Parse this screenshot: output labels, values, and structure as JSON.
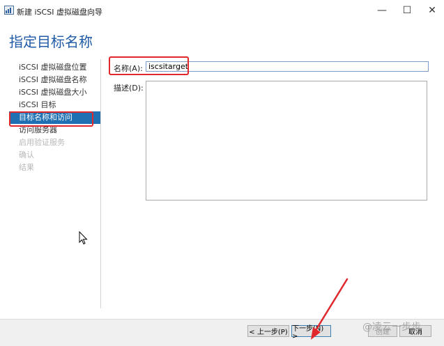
{
  "window": {
    "title": "新建 iSCSI 虚拟磁盘向导",
    "controls": {
      "minimize": "—",
      "maximize": "☐",
      "close": "✕"
    }
  },
  "page": {
    "title": "指定目标名称"
  },
  "sidebar": {
    "items": [
      {
        "label": "iSCSI 虚拟磁盘位置",
        "state": "normal"
      },
      {
        "label": "iSCSI 虚拟磁盘名称",
        "state": "normal"
      },
      {
        "label": "iSCSI 虚拟磁盘大小",
        "state": "normal"
      },
      {
        "label": "iSCSI 目标",
        "state": "normal"
      },
      {
        "label": "目标名称和访问",
        "state": "active"
      },
      {
        "label": "访问服务器",
        "state": "normal"
      },
      {
        "label": "启用验证服务",
        "state": "disabled"
      },
      {
        "label": "确认",
        "state": "disabled"
      },
      {
        "label": "结果",
        "state": "disabled"
      }
    ]
  },
  "form": {
    "name_label": "名称(A):",
    "name_value": "iscsitarget",
    "description_label": "描述(D):",
    "description_value": ""
  },
  "footer": {
    "prev_label": "< 上一步(P)",
    "next_label": "下一步(N) >",
    "create_label": "创建",
    "cancel_label": "取消"
  },
  "watermark": "@凌云一步步",
  "colors": {
    "accent": "#1f5aa6",
    "active_nav": "#1f6fb3",
    "highlight_red": "#e0282c"
  }
}
